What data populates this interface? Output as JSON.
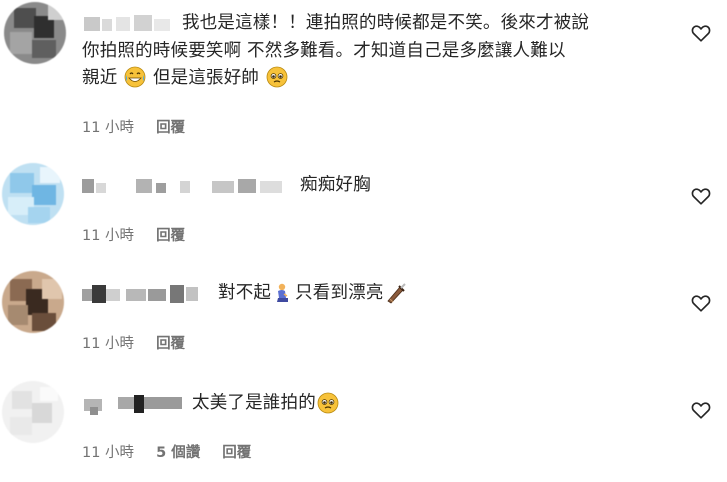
{
  "comments": [
    {
      "text_lines": [
        "我也是這樣！！連拍照的時候都是不笑。後來才被說",
        "你拍照的時候要笑啊 不然多難看。才知道自己是多麼讓人難以",
        "親近"
      ],
      "text_tail": "但是這張好帥",
      "emoji_a": "grinning-tears-emoji",
      "emoji_b": "pleading-face-emoji",
      "time": "11 小時",
      "reply_label": "回覆"
    },
    {
      "text": "痴痴好胸",
      "time": "11 小時",
      "reply_label": "回覆"
    },
    {
      "text_a": "對不起",
      "text_b": "只看到漂亮",
      "emoji_a": "person-kneeling-emoji",
      "emoji_b": "dagger-emoji",
      "time": "11 小時",
      "reply_label": "回覆"
    },
    {
      "text": "太美了是誰拍的",
      "emoji_a": "pleading-face-emoji",
      "time": "11 小時",
      "likes_label": "5 個讚",
      "reply_label": "回覆"
    }
  ],
  "icons": {
    "like": "heart-outline-icon"
  },
  "colors": {
    "text": "#262626",
    "meta": "#737373"
  }
}
